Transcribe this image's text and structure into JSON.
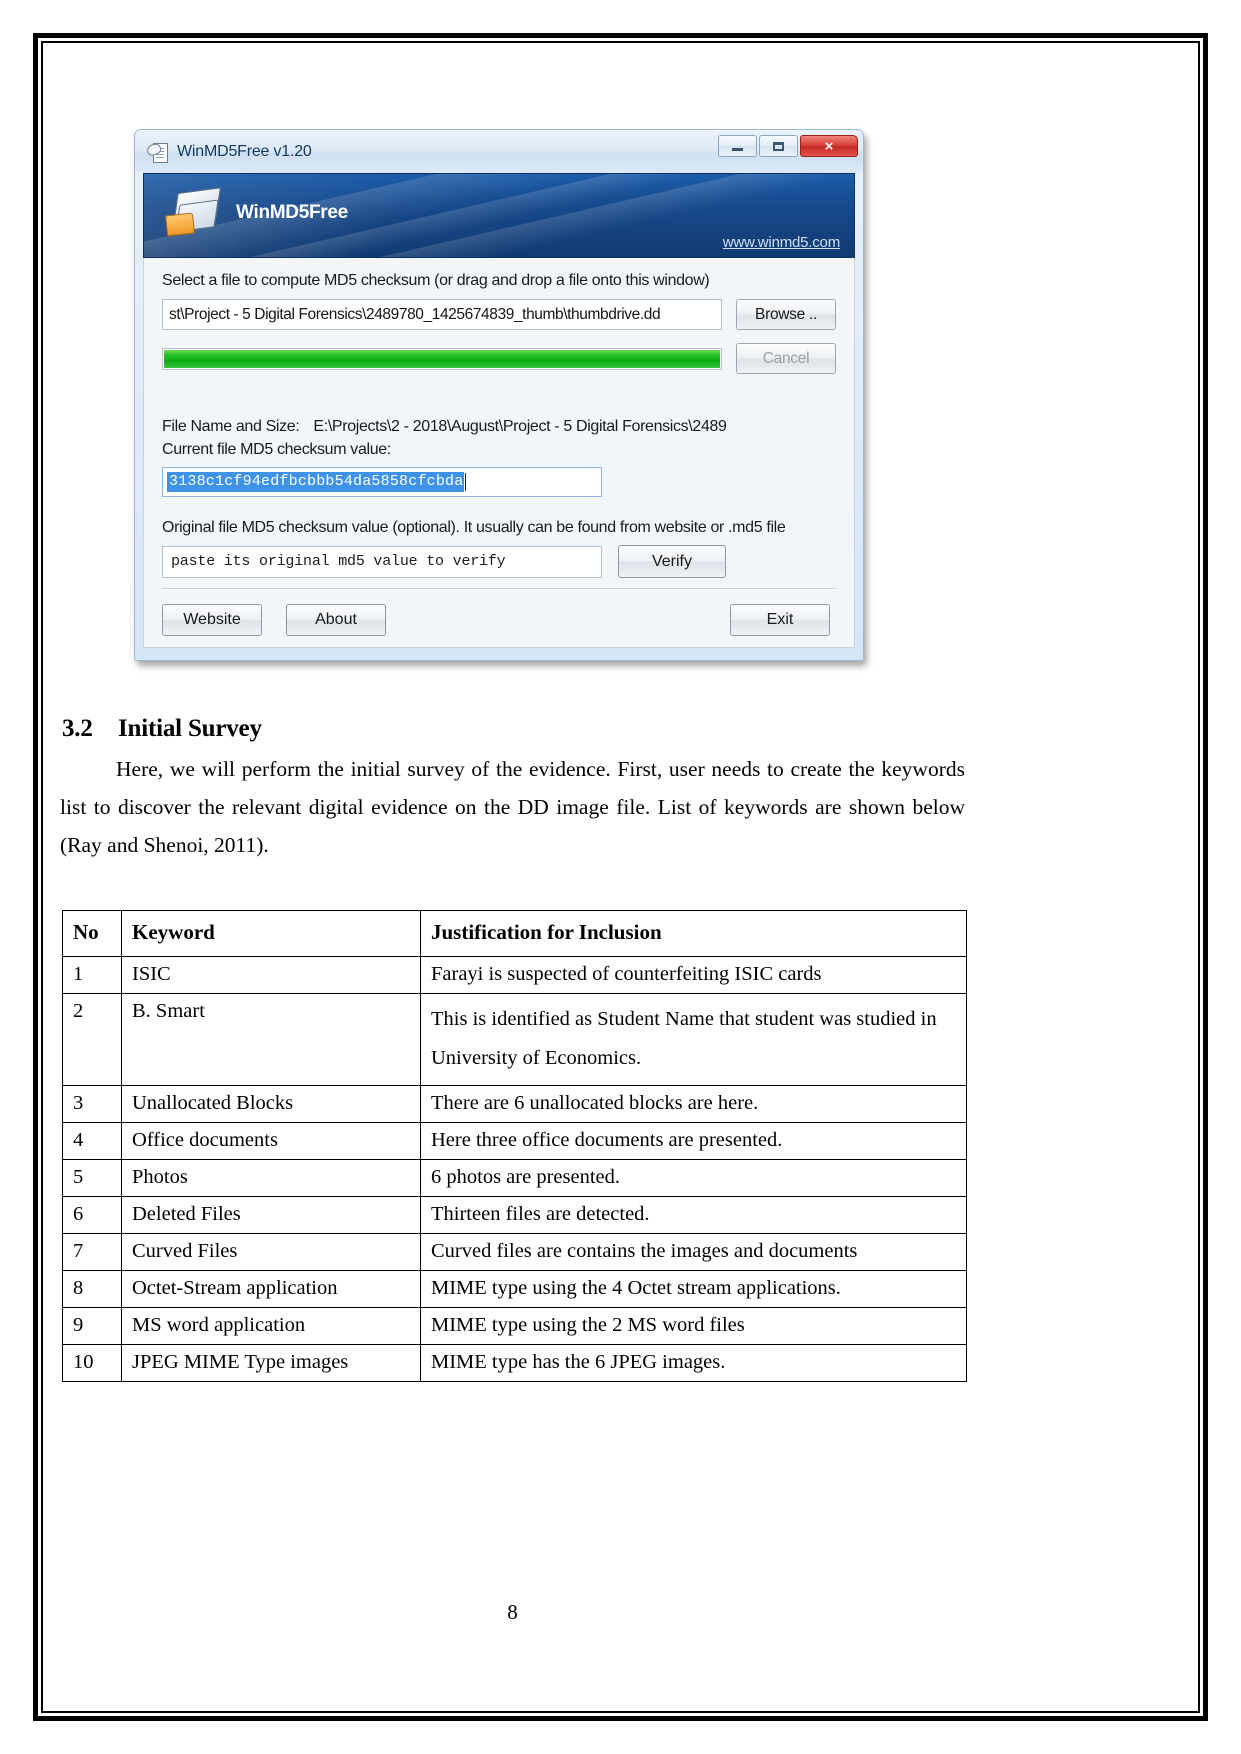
{
  "app_window": {
    "title": "WinMD5Free v1.20",
    "window_controls": {
      "minimize": "minimize-icon",
      "maximize": "maximize-icon",
      "close": "×"
    },
    "banner": {
      "product": "WinMD5Free",
      "url": "www.winmd5.com"
    },
    "select_label": "Select a file to compute MD5 checksum (or drag and drop a file onto this window)",
    "file_path_value": "st\\Project - 5 Digital Forensics\\2489780_1425674839_thumb\\thumbdrive.dd",
    "browse_button": "Browse ..",
    "cancel_button": "Cancel",
    "progress_percent": 100,
    "file_name_and_size_label": "File Name and Size:",
    "file_name_and_size_value": "E:\\Projects\\2 - 2018\\August\\Project - 5 Digital Forensics\\2489",
    "current_md5_label": "Current file MD5 checksum value:",
    "current_md5_value": "3138c1cf94edfbcbbb54da5858cfcbda",
    "original_md5_label": "Original file MD5 checksum value (optional). It usually can be found from website or .md5 file",
    "original_md5_placeholder": "paste its original md5 value to verify",
    "verify_button": "Verify",
    "website_button": "Website",
    "about_button": "About",
    "exit_button": "Exit",
    "colors": {
      "banner_blue": "#17498b",
      "progress_green": "#22c12a",
      "selection_blue": "#3e92e8",
      "close_red": "#d9423a"
    }
  },
  "document": {
    "section_number": "3.2",
    "section_title": "Initial Survey",
    "paragraph": "Here, we will perform the initial survey of the evidence. First, user needs to create the keywords list to discover the relevant digital evidence on the DD image file. List of keywords are shown below (Ray and Shenoi, 2011).",
    "table": {
      "headers": [
        "No",
        "Keyword",
        "Justification for Inclusion"
      ],
      "rows": [
        {
          "no": "1",
          "keyword": "ISIC",
          "justification": "Farayi is suspected of counterfeiting ISIC cards"
        },
        {
          "no": "2",
          "keyword": "B. Smart",
          "justification": "This is identified as Student Name that student was studied in University of Economics."
        },
        {
          "no": "3",
          "keyword": "Unallocated Blocks",
          "justification": "There are 6 unallocated blocks are here."
        },
        {
          "no": "4",
          "keyword": "Office documents",
          "justification": "Here three office documents are presented."
        },
        {
          "no": "5",
          "keyword": "Photos",
          "justification": "6 photos are presented."
        },
        {
          "no": "6",
          "keyword": "Deleted Files",
          "justification": "Thirteen files are detected."
        },
        {
          "no": "7",
          "keyword": "Curved Files",
          "justification": "Curved files are contains the images and documents"
        },
        {
          "no": "8",
          "keyword": "Octet-Stream application",
          "justification": "MIME type using the 4 Octet stream applications."
        },
        {
          "no": "9",
          "keyword": "MS word application",
          "justification": "MIME type using the 2 MS word files"
        },
        {
          "no": "10",
          "keyword": "JPEG MIME Type images",
          "justification": "MIME type has the 6 JPEG images."
        }
      ]
    },
    "page_number": "8"
  }
}
